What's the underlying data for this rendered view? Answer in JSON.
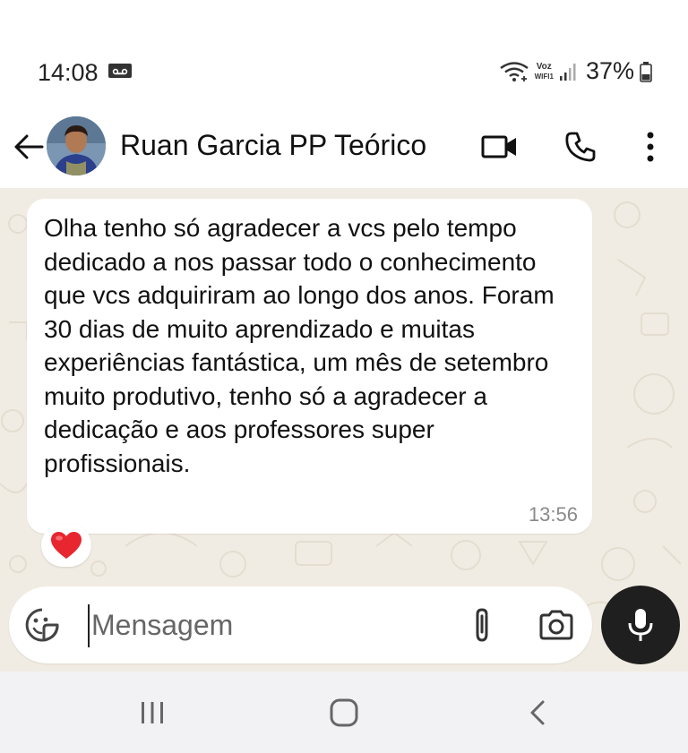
{
  "status_bar": {
    "time": "14:08",
    "battery": "37%",
    "icons": [
      "voicemail-icon",
      "wifi-calling-icon",
      "vowifi-icon",
      "signal-icon",
      "battery-icon"
    ],
    "vowifi_top": "Voz",
    "vowifi_bottom": "WIFI1"
  },
  "header": {
    "contact_name": "Ruan Garcia PP Teórico",
    "icons": [
      "back-arrow-icon",
      "video-call-icon",
      "phone-icon",
      "more-vert-icon"
    ]
  },
  "message": {
    "text": "Olha tenho só agradecer a vcs pelo tempo dedicado a nos passar todo o conhecimento que vcs adquiriram ao longo dos anos. Foram 30 dias de muito aprendizado e muitas experiências fantástica, um mês de setembro muito produtivo, tenho só a agradecer a dedicação e aos professores super profissionais.",
    "time": "13:56",
    "reaction": "heart"
  },
  "composer": {
    "placeholder": "Mensagem",
    "value": "",
    "icons": [
      "sticker-icon",
      "attach-icon",
      "camera-icon",
      "mic-icon"
    ]
  },
  "colors": {
    "chat_background": "#f1ece3",
    "bubble": "#ffffff",
    "mic_button": "#1f1f1f",
    "heart": "#e8262f"
  },
  "navbar": {
    "icons": [
      "recent-apps-icon",
      "home-icon",
      "back-icon"
    ]
  }
}
